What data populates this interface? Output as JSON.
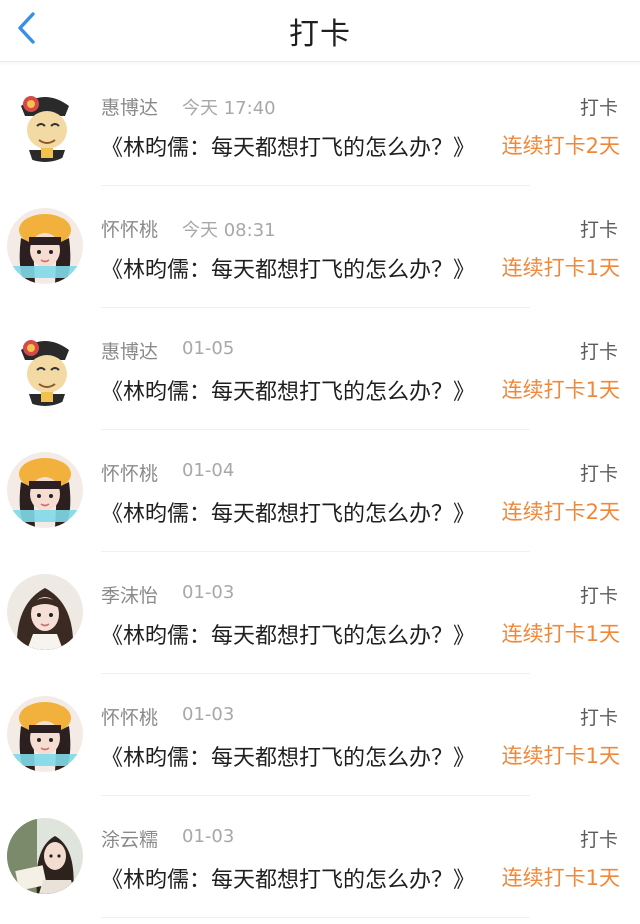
{
  "header": {
    "title": "打卡",
    "back_icon": "chevron-left-icon",
    "accent": "#3a8ee6"
  },
  "colors": {
    "streak": "#f0883a",
    "name": "#8a8a8a",
    "content": "#1f1f1f"
  },
  "items": [
    {
      "name": "惠博达",
      "time": "今天 17:40",
      "action": "打卡",
      "content": "《林昀儒：每天都想打飞的怎么办？》",
      "streak": "连续打卡2天",
      "avatar": "cartoon-official-avatar"
    },
    {
      "name": "怀怀桃",
      "time": "今天 08:31",
      "action": "打卡",
      "content": "《林昀儒：每天都想打飞的怎么办？》",
      "streak": "连续打卡1天",
      "avatar": "girl-yellow-hat-avatar"
    },
    {
      "name": "惠博达",
      "time": "01-05",
      "action": "打卡",
      "content": "《林昀儒：每天都想打飞的怎么办？》",
      "streak": "连续打卡1天",
      "avatar": "cartoon-official-avatar"
    },
    {
      "name": "怀怀桃",
      "time": "01-04",
      "action": "打卡",
      "content": "《林昀儒：每天都想打飞的怎么办？》",
      "streak": "连续打卡2天",
      "avatar": "girl-yellow-hat-avatar"
    },
    {
      "name": "季沫怡",
      "time": "01-03",
      "action": "打卡",
      "content": "《林昀儒：每天都想打飞的怎么办？》",
      "streak": "连续打卡1天",
      "avatar": "girl-long-hair-avatar"
    },
    {
      "name": "怀怀桃",
      "time": "01-03",
      "action": "打卡",
      "content": "《林昀儒：每天都想打飞的怎么办？》",
      "streak": "连续打卡1天",
      "avatar": "girl-yellow-hat-avatar"
    },
    {
      "name": "涂云糯",
      "time": "01-03",
      "action": "打卡",
      "content": "《林昀儒：每天都想打飞的怎么办？》",
      "streak": "连续打卡1天",
      "avatar": "girl-reading-avatar"
    }
  ]
}
